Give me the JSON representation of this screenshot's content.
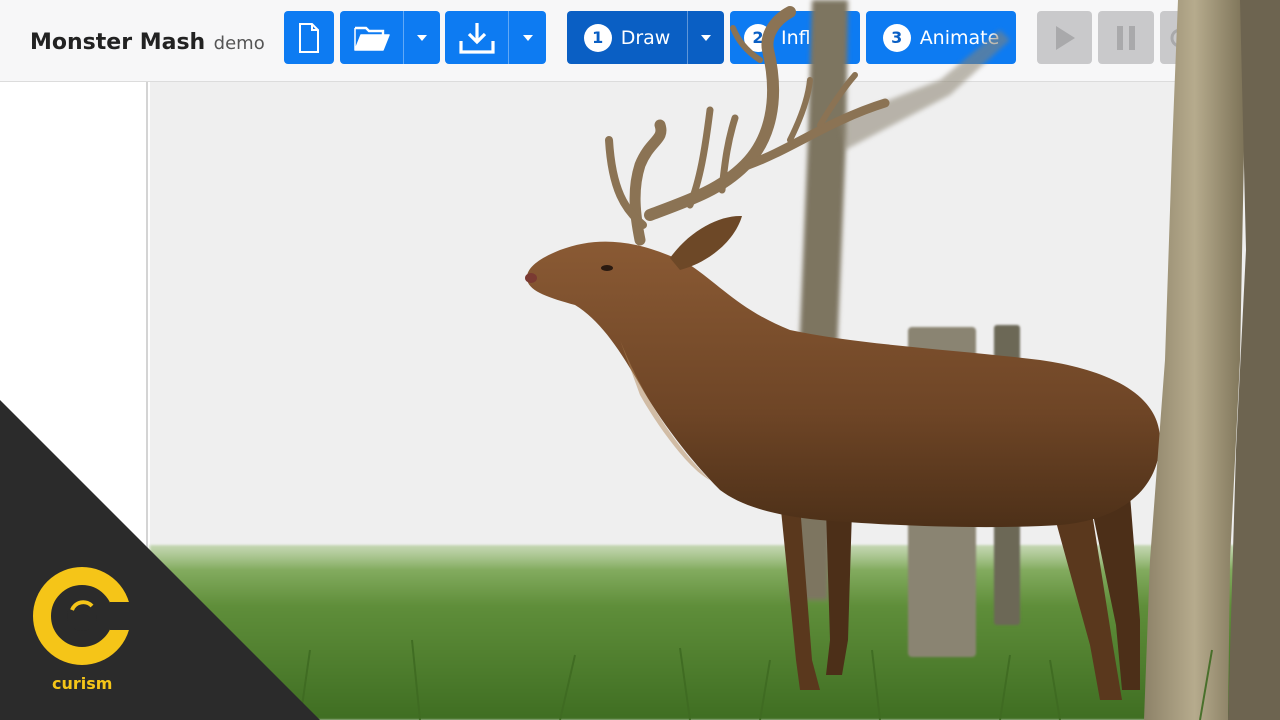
{
  "app": {
    "name": "Monster Mash",
    "subtitle": "demo"
  },
  "toolbar": {
    "new_icon": "file-icon",
    "open_icon": "folder-open-icon",
    "save_icon": "download-icon",
    "steps": [
      {
        "number": "1",
        "label": "Draw",
        "active": true
      },
      {
        "number": "2",
        "label": "Infl"
      },
      {
        "number": "3",
        "label": "Animate"
      }
    ],
    "playback_icons": [
      "play-icon",
      "pause-icon",
      "record-icon"
    ]
  },
  "watermark": {
    "brand": "curism"
  },
  "colors": {
    "toolbar_blue": "#0d7bf2",
    "active_step_blue": "#0a5fc4",
    "disabled_grey": "#c9c9cb",
    "logo_yellow": "#f5c518",
    "corner_dark": "#2b2b2b"
  }
}
